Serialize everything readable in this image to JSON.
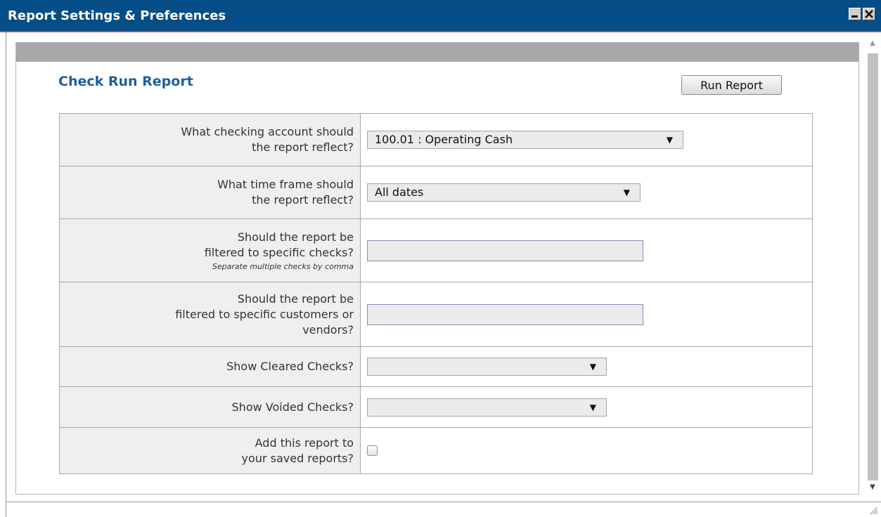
{
  "window": {
    "title": "Report Settings & Preferences",
    "minimize_icon": "minimize-icon",
    "close_icon": "close-icon",
    "title_bg": "#044d86"
  },
  "report": {
    "title": "Check Run Report",
    "run_button_label": "Run Report"
  },
  "form": {
    "account": {
      "label_line1": "What checking account should",
      "label_line2": "the report reflect?",
      "selected": "100.01 : Operating Cash"
    },
    "time_frame": {
      "label_line1": "What time frame should",
      "label_line2": "the report reflect?",
      "selected": "All dates"
    },
    "checks_filter": {
      "label_line1": "Should the report be",
      "label_line2": "filtered to specific checks?",
      "hint": "Separate multiple checks by comma",
      "value": ""
    },
    "customer_filter": {
      "label_line1": "Should the report be",
      "label_line2": "filtered to specific customers or",
      "label_line3": "vendors?",
      "value": ""
    },
    "cleared": {
      "label": "Show Cleared Checks?",
      "selected": ""
    },
    "voided": {
      "label": "Show Voided Checks?",
      "selected": ""
    },
    "save": {
      "label_line1": "Add this report to",
      "label_line2": "your saved reports?",
      "checked": false
    }
  },
  "colors": {
    "accent": "#1f5f96",
    "header_strip": "#a8a8a8",
    "label_bg": "#efefef"
  }
}
